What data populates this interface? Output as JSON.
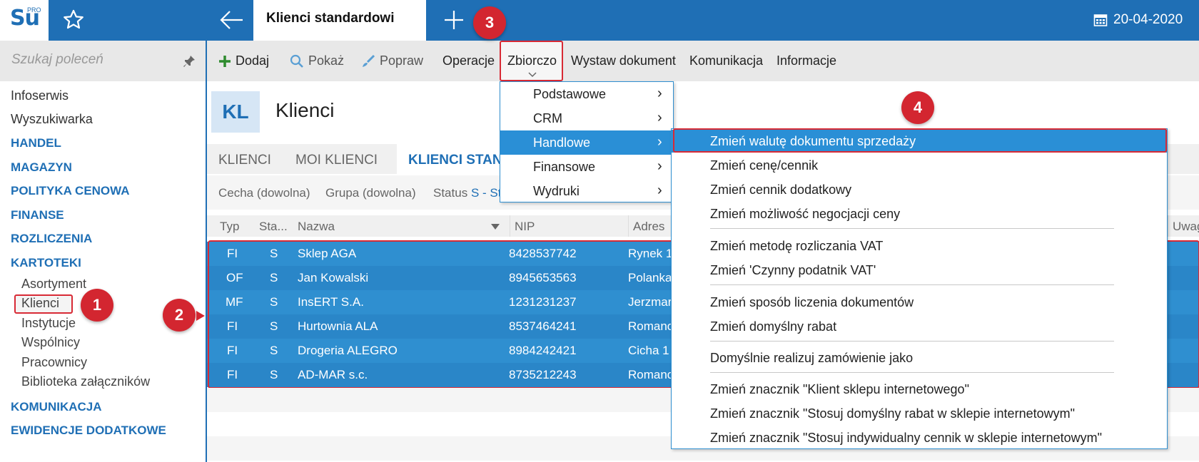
{
  "topbar": {
    "logo_text": "Su",
    "logo_sup": "PRO",
    "tab_title": "Klienci standardowi",
    "date": "20-04-2020"
  },
  "sidebar": {
    "search_placeholder": "Szukaj poleceń",
    "top_items": [
      "Infoserwis",
      "Wyszukiwarka"
    ],
    "sections": [
      "HANDEL",
      "MAGAZYN",
      "POLITYKA CENOWA",
      "FINANSE",
      "ROZLICZENIA",
      "KARTOTEKI"
    ],
    "sub_items": [
      "Asortyment",
      "Klienci",
      "Instytucje",
      "Wspólnicy",
      "Pracownicy",
      "Biblioteka załączników"
    ],
    "bottom_sections": [
      "KOMUNIKACJA",
      "EWIDENCJE DODATKOWE"
    ]
  },
  "toolbar": {
    "add": "Dodaj",
    "show": "Pokaż",
    "edit": "Popraw",
    "operations": "Operacje",
    "collective": "Zbiorczo",
    "issue_document": "Wystaw dokument",
    "communication": "Komunikacja",
    "information": "Informacje"
  },
  "header": {
    "badge": "KL",
    "title": "Klienci"
  },
  "subtabs": [
    "KLIENCI",
    "MOI KLIENCI",
    "KLIENCI STAN"
  ],
  "filters": {
    "feature": "Cecha (dowolna)",
    "group": "Grupa (dowolna)",
    "status_label": "Status",
    "status_value": "S - St"
  },
  "columns": [
    "Typ",
    "Sta...",
    "Nazwa",
    "NIP",
    "Adres",
    "Uwag"
  ],
  "rows": [
    {
      "typ": "FI",
      "status": "S",
      "nazwa": "Sklep AGA",
      "nip": "8428537742",
      "adres": "Rynek 1"
    },
    {
      "typ": "OF",
      "status": "S",
      "nazwa": "Jan Kowalski",
      "nip": "8945653563",
      "adres": "Polanka"
    },
    {
      "typ": "MF",
      "status": "S",
      "nazwa": "InsERT S.A.",
      "nip": "1231231237",
      "adres": "Jerzmar"
    },
    {
      "typ": "FI",
      "status": "S",
      "nazwa": "Hurtownia ALA",
      "nip": "8537464241",
      "adres": "Romano"
    },
    {
      "typ": "FI",
      "status": "S",
      "nazwa": "Drogeria ALEGRO",
      "nip": "8984242421",
      "adres": "Cicha  1"
    },
    {
      "typ": "FI",
      "status": "S",
      "nazwa": "AD-MAR s.c.",
      "nip": "8735212243",
      "adres": "Romano"
    }
  ],
  "menu_level1": [
    "Podstawowe",
    "CRM",
    "Handlowe",
    "Finansowe",
    "Wydruki"
  ],
  "menu_level2": [
    "Zmień walutę dokumentu sprzedaży",
    "Zmień cenę/cennik",
    "Zmień cennik dodatkowy",
    "Zmień możliwość negocjacji ceny",
    "Zmień metodę rozliczania VAT",
    "Zmień 'Czynny podatnik VAT'",
    "Zmień sposób liczenia dokumentów",
    "Zmień domyślny rabat",
    "Domyślnie realizuj zamówienie jako",
    "Zmień znacznik \"Klient sklepu internetowego\"",
    "Zmień znacznik \"Stosuj domyślny rabat w sklepie internetowym\"",
    "Zmień znacznik \"Stosuj indywidualny cennik w sklepie internetowym\""
  ],
  "callouts": [
    "1",
    "2",
    "3",
    "4"
  ],
  "colors": {
    "brand_blue": "#1f6fb5",
    "selection_blue": "#2a8fd6",
    "callout_red": "#d32630"
  }
}
